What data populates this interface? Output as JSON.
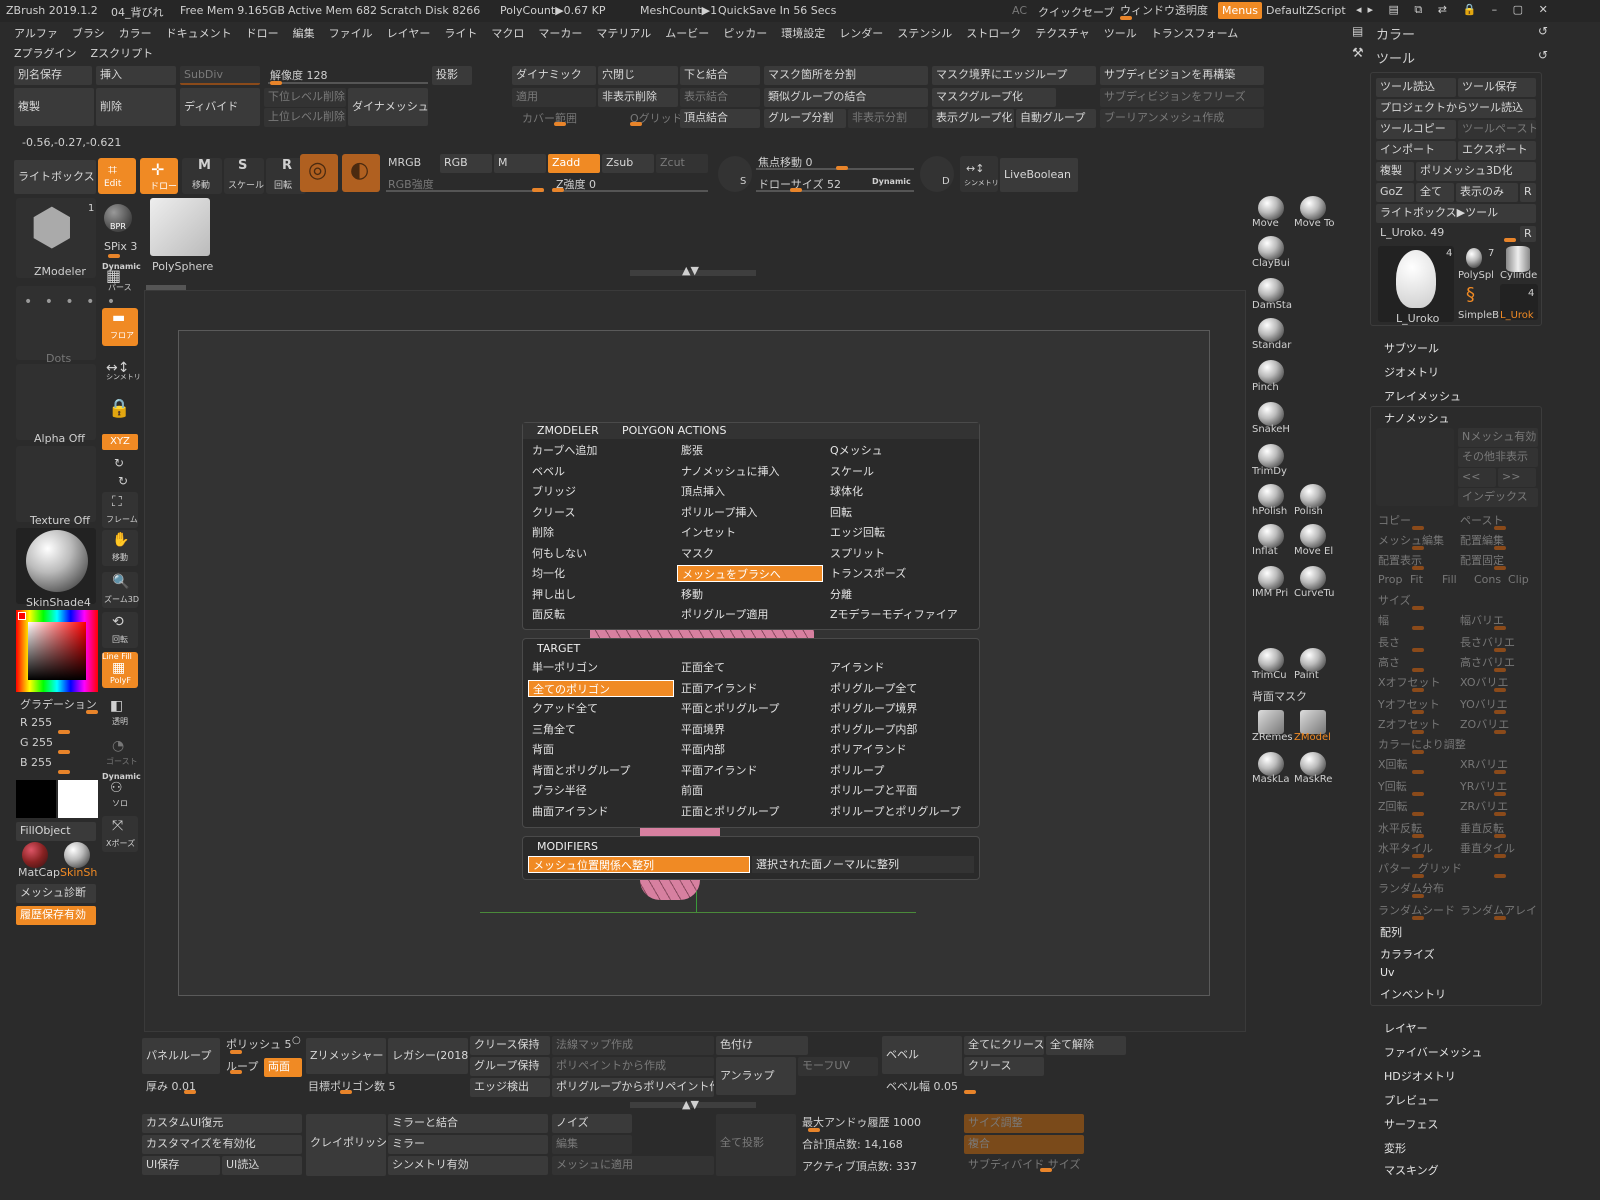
{
  "titlebar": {
    "app": "ZBrush 2019.1.2",
    "doc": "04_背びれ",
    "free_mem": "Free Mem 9.165GB",
    "active_mem": "Active Mem 682",
    "scratch": "Scratch Disk 8266",
    "polycount": "PolyCount▶0.67 KP",
    "meshcount": "MeshCount▶1",
    "quicksave": "QuickSave In 56 Secs",
    "ac": "AC",
    "quick_save_btn": "クイックセーブ",
    "transparency": "ウィンドウ透明度",
    "menus": "Menus",
    "default_script": "DefaultZScript"
  },
  "menubar": [
    "アルファ",
    "ブラシ",
    "カラー",
    "ドキュメント",
    "ドロー",
    "編集",
    "ファイル",
    "レイヤー",
    "ライト",
    "マクロ",
    "マーカー",
    "マテリアル",
    "ムービー",
    "ピッカー",
    "環境設定",
    "レンダー",
    "ステンシル",
    "ストローク",
    "テクスチャ",
    "ツール",
    "トランスフォーム"
  ],
  "menubar2": [
    "Zプラグイン",
    "Zスクリプト"
  ],
  "top": {
    "alias_save": "別名保存",
    "insert": "挿入",
    "subdiv": "SubDiv",
    "resolution": "解像度 128",
    "project": "投影",
    "duplicate": "複製",
    "delete": "削除",
    "divide": "ディバイド",
    "lower_del": "下位レベル削除",
    "upper_del": "上位レベル削除",
    "dynamesh": "ダイナメッシュ",
    "dynamic": "ダイナミック",
    "close_holes": "穴閉じ",
    "merge_down": "下と結合",
    "split_mask": "マスク箇所を分割",
    "edge_loop_mask": "マスク境界にエッジループ",
    "resub": "サブディビジョンを再構築",
    "apply": "適用",
    "del_hidden": "非表示削除",
    "show_merge": "表示結合",
    "merge_similar": "類似グループの結合",
    "mask_group": "マスクグループ化",
    "freeze_sub": "サブディビジョンをフリーズ",
    "cover": "カバー範囲",
    "q_grid": "Qグリッド",
    "weld_pts": "頂点結合",
    "group_split": "グループ分割",
    "hidden_split": "非表示分割",
    "visible_group": "表示グループ化",
    "auto_group": "自動グループ",
    "boolean": "ブーリアンメッシュ作成",
    "coords": "-0.56,-0.27,-0.621"
  },
  "shelf": {
    "lightbox": "ライトボックス",
    "edit": "Edit",
    "draw": "ドロー",
    "move": "移動",
    "scale": "スケール",
    "rotate": "回転",
    "mrgb": "MRGB",
    "rgb": "RGB",
    "m": "M",
    "zadd": "Zadd",
    "zsub": "Zsub",
    "zcut": "Zcut",
    "rgb_int": "RGB強度",
    "z_int": "Z強度 0",
    "focal": "焦点移動 0",
    "draw_size": "ドローサイズ 52",
    "dynamic": "Dynamic",
    "sym": "シンメトリ",
    "liveboolean": "LiveBoolean"
  },
  "leftpanel": {
    "zmodeler": "ZModeler",
    "spix": "SPix 3",
    "dynamic": "Dynamic",
    "perspective": "パース",
    "dots": "Dots",
    "floor": "フロア",
    "alpha_off": "Alpha Off",
    "symmetry": "シンメトリ",
    "texture_off": "Texture Off",
    "frame": "フレーム",
    "xyz": "XYZ",
    "skinshade": "SkinShade4",
    "move": "移動",
    "zoom": "ズーム3D",
    "rotate": "回転",
    "polyf": "PolyF",
    "transp": "透明",
    "ghost": "ゴースト",
    "solo": "ソロ",
    "xpose": "Xポーズ",
    "linefill": "Line Fill",
    "gradation": "グラデーション",
    "r": "R 255",
    "g": "G 255",
    "b": "B 255",
    "fillobject": "FillObject",
    "matcap": "MatCap",
    "skinsh": "SkinSh",
    "mesh_diag": "メッシュ診断",
    "history": "履歴保存有効",
    "one": "1",
    "polysphere": "PolySphere",
    "bpr": "BPR"
  },
  "brushes": [
    {
      "name": "Move"
    },
    {
      "name": "Move To"
    },
    {
      "name": "ClayBui"
    },
    {
      "name": "DamSta"
    },
    {
      "name": "Standar"
    },
    {
      "name": "Pinch"
    },
    {
      "name": "SnakeH"
    },
    {
      "name": "TrimDy"
    },
    {
      "name": "hPolish"
    },
    {
      "name": "Polish"
    },
    {
      "name": "Inflat"
    },
    {
      "name": "Move El"
    },
    {
      "name": "IMM Pri"
    },
    {
      "name": "CurveTu"
    },
    {
      "name": "TrimCu"
    },
    {
      "name": "Paint"
    },
    {
      "name": "背面マスク"
    },
    {
      "name": "ZRemes"
    },
    {
      "name": "ZModel"
    },
    {
      "name": "MaskLa"
    },
    {
      "name": "MaskRe"
    }
  ],
  "popup": {
    "tab1": "ZMODELER",
    "tab2": "POLYGON ACTIONS",
    "actions": [
      [
        "カーブへ追加",
        "膨張",
        "Qメッシュ"
      ],
      [
        "ベベル",
        "ナノメッシュに挿入",
        "スケール"
      ],
      [
        "ブリッジ",
        "頂点挿入",
        "球体化"
      ],
      [
        "クリース",
        "ポリループ挿入",
        "回転"
      ],
      [
        "削除",
        "インセット",
        "エッジ回転"
      ],
      [
        "何もしない",
        "マスク",
        "スプリット"
      ],
      [
        "均一化",
        "メッシュをブラシへ",
        "トランスポーズ"
      ],
      [
        "押し出し",
        "移動",
        "分離"
      ],
      [
        "面反転",
        "ポリグループ適用",
        "Zモデラーモディファイア"
      ]
    ],
    "target_title": "TARGET",
    "targets": [
      [
        "単一ポリゴン",
        "正面全て",
        "アイランド"
      ],
      [
        "全てのポリゴン",
        "正面アイランド",
        "ポリグループ全て"
      ],
      [
        "クアッド全て",
        "平面とポリグループ",
        "ポリグループ境界"
      ],
      [
        "三角全て",
        "平面境界",
        "ポリグループ内部"
      ],
      [
        "背面",
        "平面内部",
        "ポリアイランド"
      ],
      [
        "背面とポリグループ",
        "平面アイランド",
        "ポリループ"
      ],
      [
        "ブラシ半径",
        "前面",
        "ポリループと平面"
      ],
      [
        "曲面アイランド",
        "正面とポリグループ",
        "ポリループとポリグループ"
      ]
    ],
    "modifiers_title": "MODIFIERS",
    "mod1": "メッシュ位置関係へ整列",
    "mod2": "選択された面ノーマルに整列"
  },
  "right": {
    "color": "カラー",
    "tool": "ツール",
    "load_tool": "ツール読込",
    "save_tool": "ツール保存",
    "load_project": "プロジェクトからツール読込",
    "copy_tool": "ツールコピー",
    "paste_tool": "ツールペースト",
    "import": "インポート",
    "export": "エクスポート",
    "clone": "複製",
    "polymesh3d": "ポリメッシュ3D化",
    "goz": "GoZ",
    "all": "全て",
    "visible": "表示のみ",
    "r": "R",
    "lightbox_tool": "ライトボックス▶ツール",
    "uroko": "L_Uroko. 49",
    "thumb_main": "L_Uroko",
    "thumb_ps": "PolySpl",
    "thumb_cyl": "Cylinde",
    "thumb_simple": "SimpleB",
    "thumb_uro": "L_Urok",
    "n4": "4",
    "n7": "7",
    "n4b": "4",
    "subtool": "サブツール",
    "geometry": "ジオメトリ",
    "arraymesh": "アレイメッシュ",
    "nanomesh": "ナノメッシュ",
    "n_enable": "Nメッシュ有効",
    "other_hide": "その他非表示",
    "prev": "<<",
    "next": ">>",
    "index": "インデックス",
    "copy": "コピー",
    "paste": "ペースト",
    "mesh_edit": "メッシュ編集",
    "place_edit": "配置編集",
    "place_show": "配置表示",
    "place_fix": "配置固定",
    "prop": "Prop",
    "fit": "Fit",
    "fill": "Fill",
    "cons": "Cons",
    "clip": "Clip",
    "size": "サイズ",
    "width": "幅",
    "width_var": "幅バリエ",
    "length": "長さ",
    "length_var": "長さバリエ",
    "height": "高さ",
    "height_var": "高さバリエ",
    "xoff": "Xオフセット",
    "xoff_var": "XOバリエ",
    "yoff": "Yオフセット",
    "yoff_var": "YOバリエ",
    "zoff": "Zオフセット",
    "zoff_var": "ZOバリエ",
    "color_adj": "カラーにより調整",
    "xrot": "X回転",
    "xrot_var": "XRバリエ",
    "yrot": "Y回転",
    "yrot_var": "YRバリエ",
    "zrot": "Z回転",
    "zrot_var": "ZRバリエ",
    "hflip": "水平反転",
    "vflip": "垂直反転",
    "htile": "水平タイル",
    "vtile": "垂直タイル",
    "pattern": "パター",
    "grid": "グリッド",
    "rand_dist": "ランダム分布",
    "rand_seed": "ランダムシード",
    "rand_array": "ランダムアレイ",
    "array": "配列",
    "colorize": "カラライズ",
    "uv": "Uv",
    "inventory": "インベントリ",
    "layer": "レイヤー",
    "fiber": "ファイバーメッシュ",
    "hdgeo": "HDジオメトリ",
    "preview": "プレビュー",
    "surface": "サーフェス",
    "deform": "変形",
    "masking": "マスキング"
  },
  "bottom": {
    "panel_loop": "パネルループ",
    "polish": "ポリッシュ 5",
    "loop": "ループ",
    "both": "両面",
    "zremesher": "Zリメッシャー",
    "legacy": "レガシー(2018)",
    "crease_keep": "クリース保持",
    "normal_map": "法線マップ作成",
    "colorize": "色付け",
    "bevel": "ベベル",
    "crease_all": "全てにクリース",
    "clear_all": "全て解除",
    "group_keep": "グループ保持",
    "polypaint_from": "ポリペイントから作成",
    "unwrap": "アンラップ",
    "morph_uv": "モーフUV",
    "crease": "クリース",
    "thickness": "厚み 0.01",
    "target_poly": "目標ポリゴン数 5",
    "edge_detect": "エッジ検出",
    "pg_to_pp": "ポリグループからポリペイント作",
    "bevel_w": "ベベル幅 0.05",
    "custom_ui": "カスタムUI復元",
    "enable_custom": "カスタマイズを有効化",
    "ui_save": "UI保存",
    "ui_load": "UI読込",
    "claypolish": "クレイポリッシ",
    "mirror_weld": "ミラーと結合",
    "mirror": "ミラー",
    "sym_enable": "シンメトリ有効",
    "noise": "ノイズ",
    "edit": "編集",
    "apply_mesh": "メッシュに適用",
    "project_all": "全て投影",
    "max_undo": "最大アンドゥ履歴 1000",
    "total_pts": "合計頂点数: 14,168",
    "active_pts": "アクティブ頂点数: 337",
    "size_adj": "サイズ調整",
    "combine": "複合",
    "subdiv_size": "サブディバイド サイズ"
  }
}
